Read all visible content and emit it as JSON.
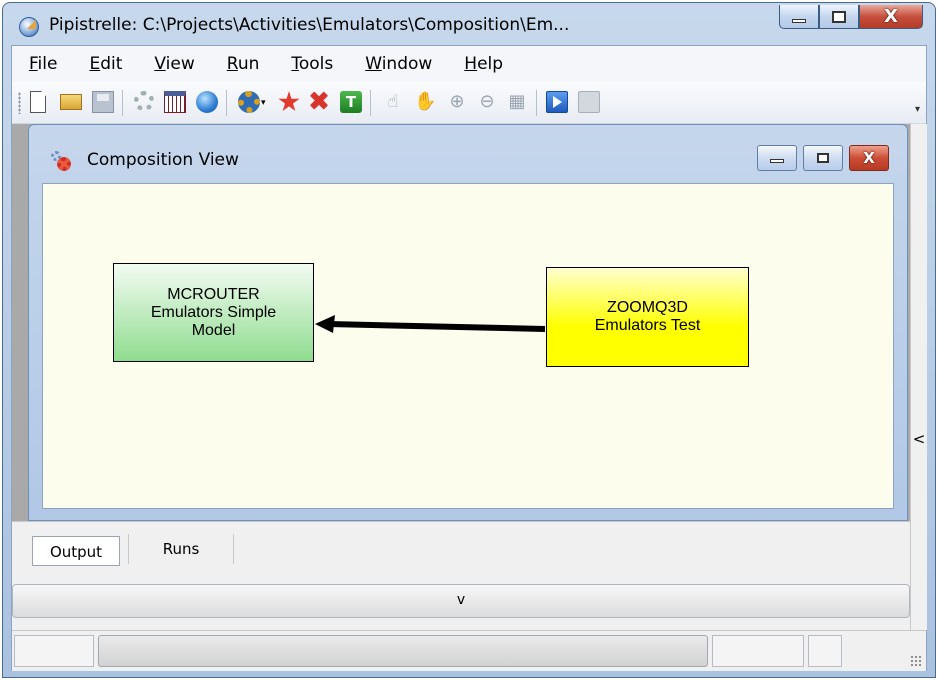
{
  "window": {
    "title": "Pipistrelle: C:\\Projects\\Activities\\Emulators\\Composition\\Em...",
    "caption_close": "X"
  },
  "menu": {
    "items": [
      {
        "label": "File",
        "key": "F",
        "rest": "ile"
      },
      {
        "label": "Edit",
        "key": "E",
        "rest": "dit"
      },
      {
        "label": "View",
        "key": "V",
        "rest": "iew"
      },
      {
        "label": "Run",
        "key": "R",
        "rest": "un"
      },
      {
        "label": "Tools",
        "key": "T",
        "rest": "ools"
      },
      {
        "label": "Window",
        "key": "W",
        "rest": "indow"
      },
      {
        "label": "Help",
        "key": "H",
        "rest": "elp"
      }
    ]
  },
  "toolbar": {
    "icons": [
      "new-file-icon",
      "open-folder-icon",
      "save-icon",
      "options-gear-icon",
      "table-icon",
      "globe-icon",
      "add-component-gear-icon",
      "connect-icon",
      "delete-icon",
      "trigger-icon",
      "pointer-icon",
      "pan-hand-icon",
      "zoom-in-icon",
      "zoom-out-icon",
      "zoom-fit-icon",
      "run-icon",
      "stop-icon"
    ],
    "delete_glyph": "✖",
    "trigger_glyph": "T",
    "dropdown_glyph": "▾",
    "overflow_glyph": "▾"
  },
  "composition_view": {
    "title": "Composition View",
    "close_glyph": "X",
    "nodes": {
      "source": {
        "line1": "MCROUTER",
        "line2": "Emulators Simple",
        "line3": "Model",
        "fill": "#8fdc8f"
      },
      "target": {
        "line1": "ZOOMQ3D",
        "line2": "Emulators Test",
        "fill": "#ffff00"
      }
    }
  },
  "side_panel": {
    "collapse_glyph": "<"
  },
  "tabs": [
    {
      "label": "Output",
      "active": true
    },
    {
      "label": "Runs",
      "active": false
    }
  ],
  "bottom_panel": {
    "expander_glyph": "v"
  },
  "status": {
    "progress": 1.0
  }
}
